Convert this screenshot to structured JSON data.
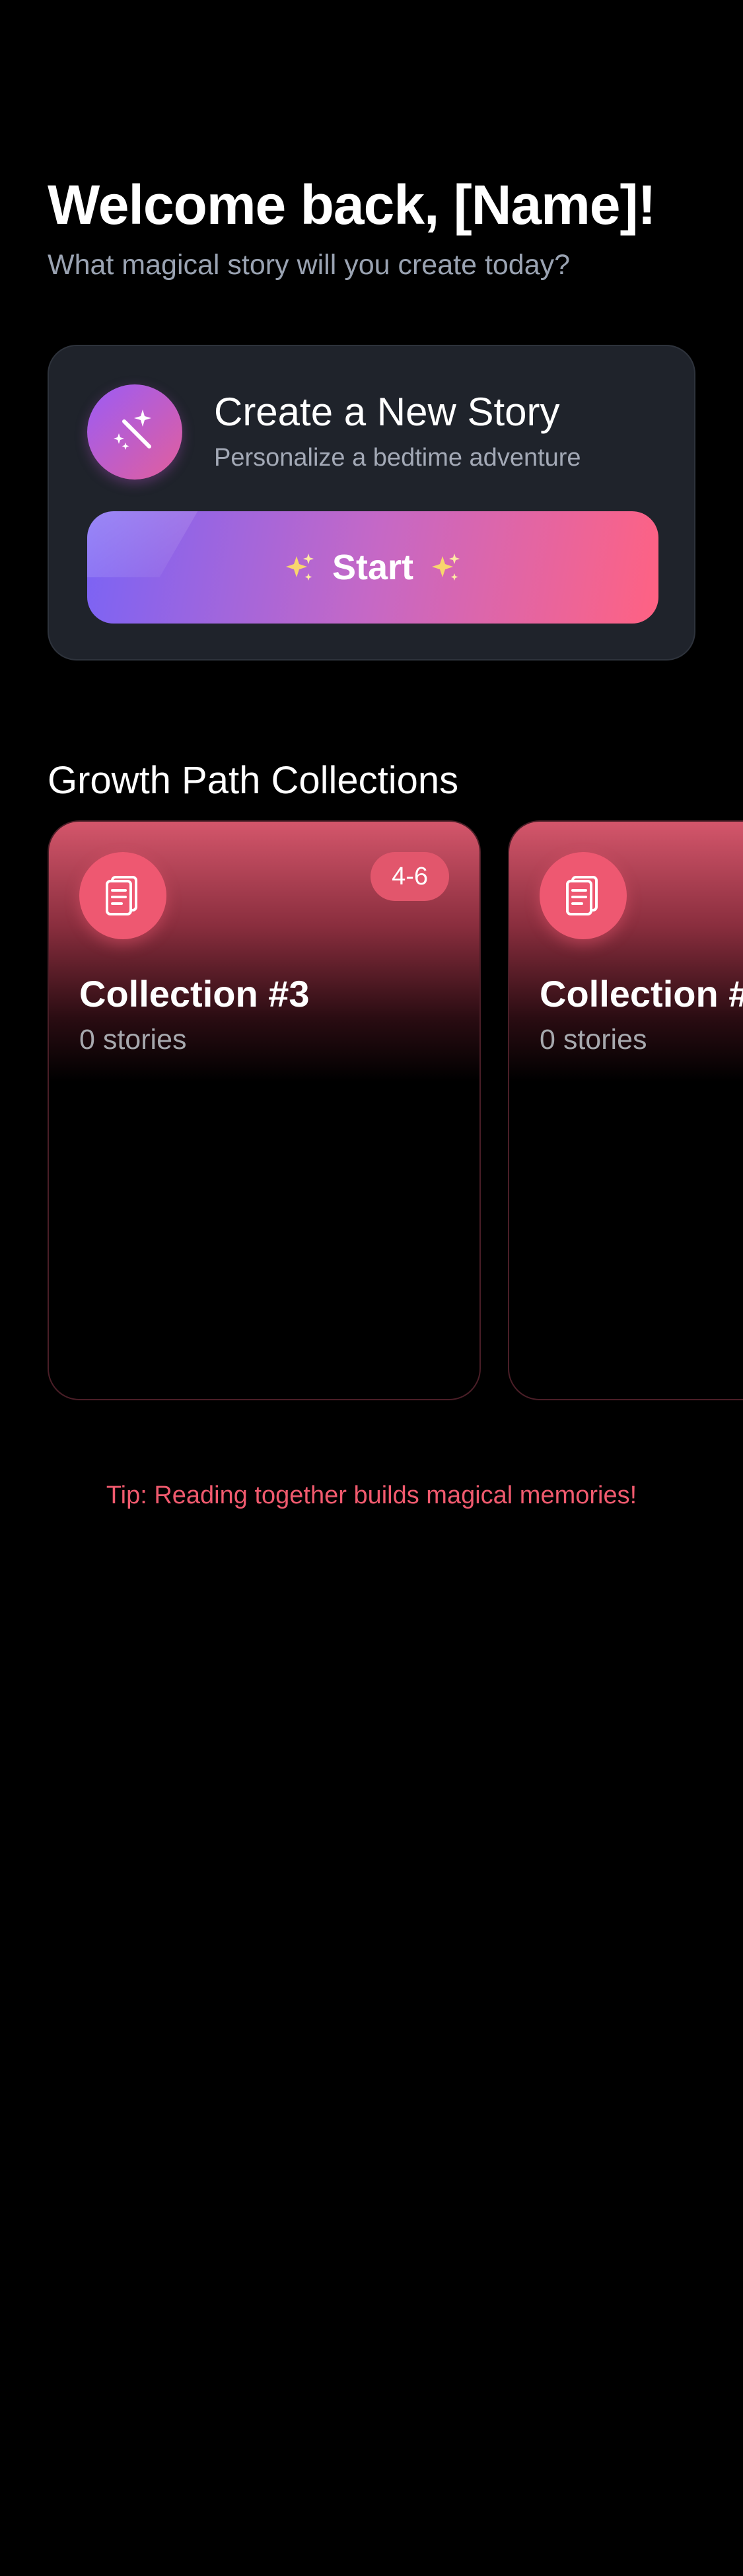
{
  "header": {
    "title": "Welcome back, [Name]!",
    "subtitle": "What magical story will you create today?"
  },
  "create_card": {
    "icon": "magic-wand-icon",
    "title": "Create a New Story",
    "subtitle": "Personalize a bedtime adventure",
    "start_label": "Start",
    "start_icons": [
      "sparkles-icon",
      "sparkles-icon"
    ]
  },
  "section": {
    "title": "Growth Path Collections"
  },
  "collections": [
    {
      "icon": "book-icon",
      "age_range": "4-6",
      "title": "Collection #3",
      "count": "0 stories"
    },
    {
      "icon": "book-icon",
      "age_range": "",
      "title": "Collection #",
      "count": "0 stories"
    }
  ],
  "tip": "Tip: Reading together builds magical memories!",
  "colors": {
    "background": "#000000",
    "card": "#1f232b",
    "accent_pink": "#ee5871",
    "accent_purple": "#7a63f5",
    "muted_text": "#9aa3b2",
    "tip_text": "#f05a6e"
  }
}
